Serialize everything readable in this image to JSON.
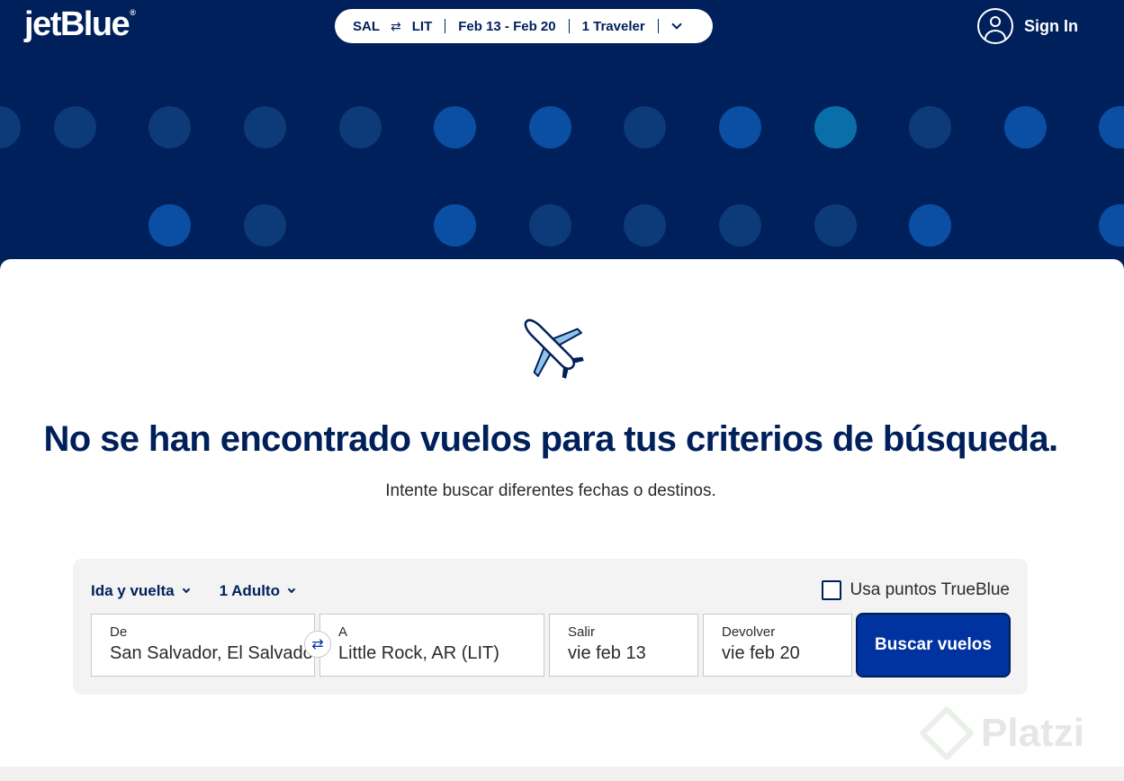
{
  "brand": {
    "logo": "jetBlue",
    "trademark": "®"
  },
  "trip_summary": {
    "origin": "SAL",
    "swap_symbol": "⇄",
    "destination": "LIT",
    "dates": "Feb 13 - Feb 20",
    "travelers": "1 Traveler"
  },
  "account": {
    "sign_in": "Sign In"
  },
  "message": {
    "title": "No se han encontrado vuelos para tus criterios de búsqueda.",
    "subtitle": "Intente buscar diferentes fechas o destinos."
  },
  "search_form": {
    "trip_type": "Ida y vuelta",
    "passengers": "1 Adulto",
    "use_points_label": "Usa puntos TrueBlue",
    "use_points_checked": false,
    "from": {
      "label": "De",
      "value": "San Salvador,  El Salvador"
    },
    "swap_symbol": "⇄",
    "to": {
      "label": "A",
      "value": "Little Rock, AR (LIT)"
    },
    "depart": {
      "label": "Salir",
      "value": "vie feb 13"
    },
    "return": {
      "label": "Devolver",
      "value": "vie feb 20"
    },
    "submit": "Buscar vuelos"
  },
  "watermark": {
    "text": "Platzi"
  },
  "colors": {
    "navy": "#00205b",
    "royal_blue": "#0033a0",
    "dot_dark": "#0d3a78",
    "dot_mid": "#0a4fa3",
    "dot_teal": "#0a6ea8",
    "plane_light": "#8fc3ea"
  },
  "icons": [
    "swap-icon",
    "chevron-down-icon",
    "user-icon",
    "airplane-icon",
    "checkbox-icon"
  ]
}
